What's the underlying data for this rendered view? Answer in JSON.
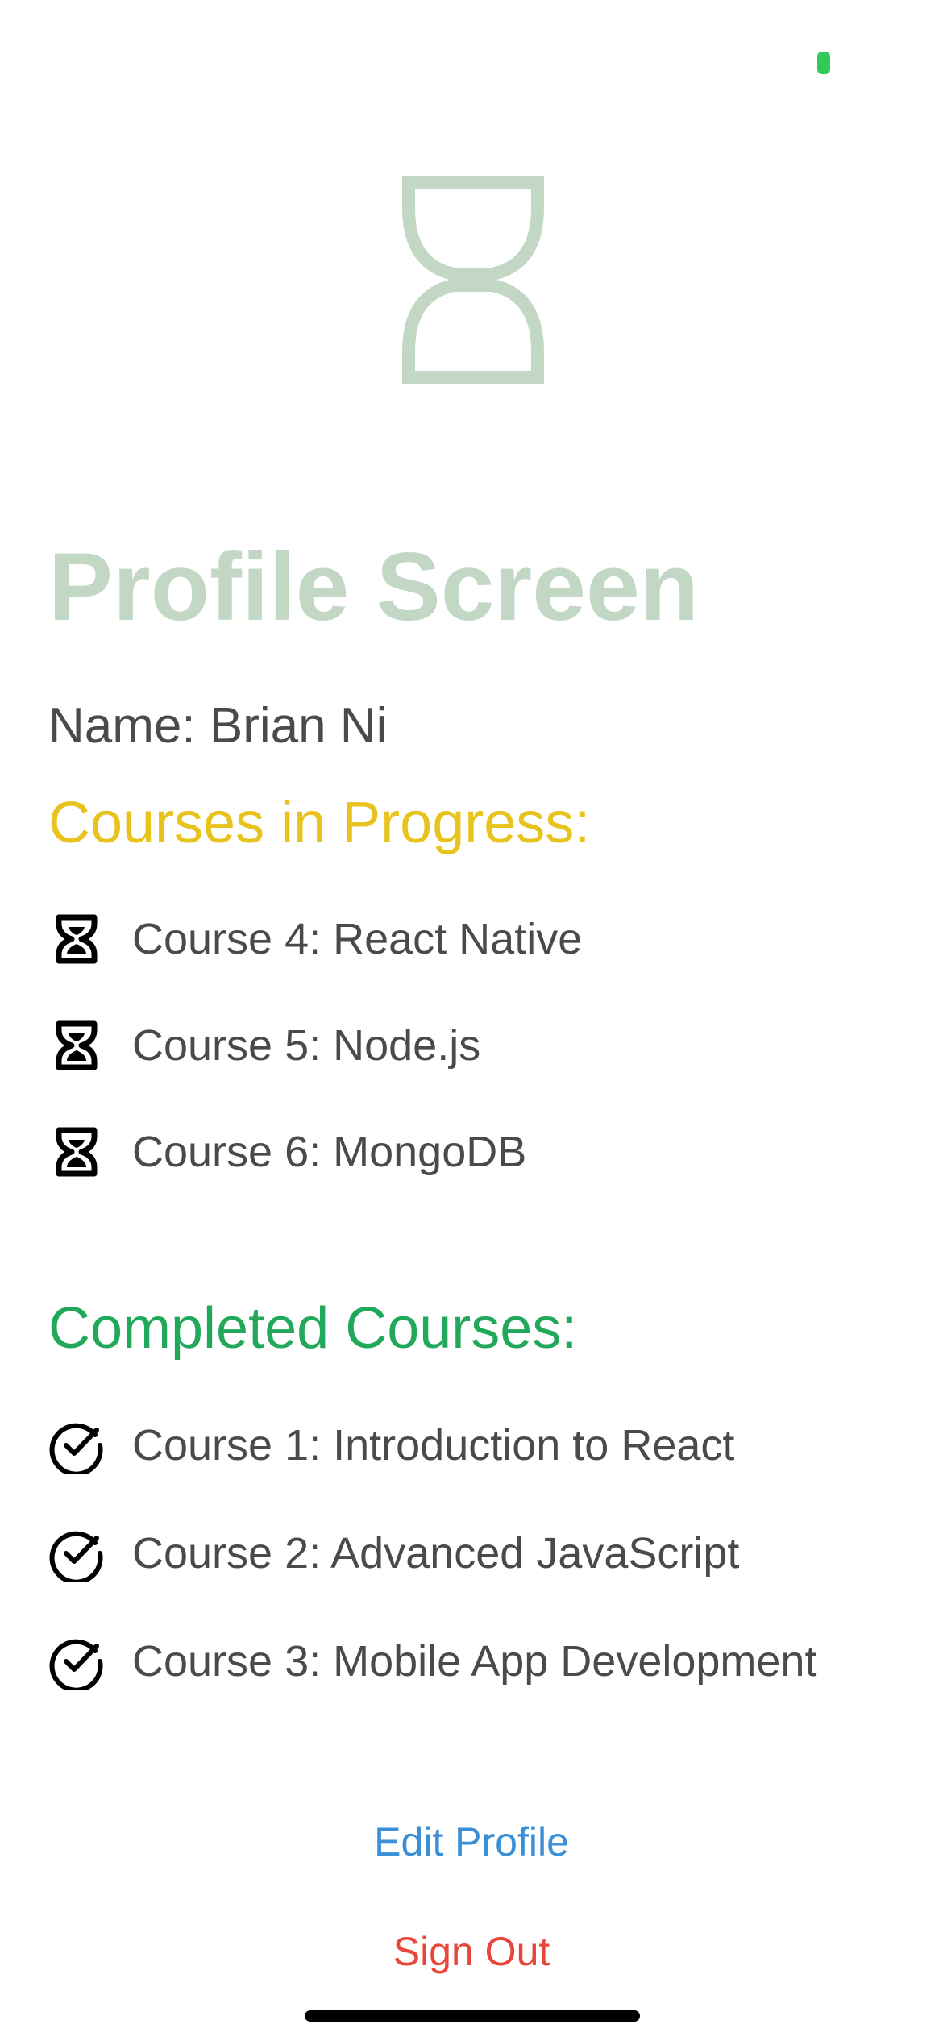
{
  "status_bar": {
    "indicator_color": "#34c759"
  },
  "logo": {
    "icon": "hourglass-icon",
    "color": "#c3d8c4"
  },
  "profile": {
    "title": "Profile Screen",
    "name_line": "Name: Brian Ni"
  },
  "courses_in_progress": {
    "heading": "Courses in Progress:",
    "heading_color": "#e8c31d",
    "icon": "hourglass-icon",
    "items": [
      {
        "label": "Course 4: React Native"
      },
      {
        "label": "Course 5: Node.js"
      },
      {
        "label": "Course 6: MongoDB"
      }
    ]
  },
  "completed_courses": {
    "heading": "Completed Courses:",
    "heading_color": "#22a85a",
    "icon": "check-circle-icon",
    "items": [
      {
        "label": "Course 1: Introduction to React"
      },
      {
        "label": "Course 2: Advanced JavaScript"
      },
      {
        "label": "Course 3: Mobile App Development"
      }
    ]
  },
  "actions": {
    "edit_profile": "Edit Profile",
    "edit_profile_color": "#3a8fd6",
    "sign_out": "Sign Out",
    "sign_out_color": "#e8463a"
  }
}
